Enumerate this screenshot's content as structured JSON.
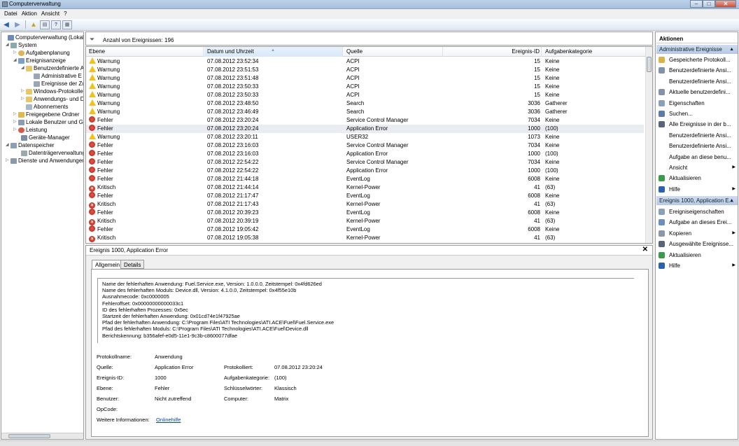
{
  "window": {
    "title": "Computerverwaltung",
    "min": "–",
    "max": "□",
    "close": "✕"
  },
  "menu": [
    "Datei",
    "Aktion",
    "Ansicht",
    "?"
  ],
  "tree": [
    {
      "label": "Computerverwaltung (Lokal)",
      "icon": "computer-icon"
    },
    {
      "label": "System",
      "icon": "system-icon"
    },
    {
      "label": "Aufgabenplanung",
      "icon": "clock-icon"
    },
    {
      "label": "Ereignisanzeige",
      "icon": "event-viewer-icon"
    },
    {
      "label": "Benutzerdefinierte A",
      "icon": "folder-icon"
    },
    {
      "label": "Administrative E",
      "icon": "filter-icon"
    },
    {
      "label": "Ereignisse der Zu",
      "icon": "filter-icon"
    },
    {
      "label": "Windows-Protokolle",
      "icon": "folder-icon"
    },
    {
      "label": "Anwendungs- und D",
      "icon": "folder-icon"
    },
    {
      "label": "Abonnements",
      "icon": "subscription-icon"
    },
    {
      "label": "Freigegebene Ordner",
      "icon": "shared-folder-icon"
    },
    {
      "label": "Lokale Benutzer und Gr",
      "icon": "users-icon"
    },
    {
      "label": "Leistung",
      "icon": "performance-icon"
    },
    {
      "label": "Geräte-Manager",
      "icon": "device-manager-icon"
    },
    {
      "label": "Datenspeicher",
      "icon": "storage-icon"
    },
    {
      "label": "Datenträgerverwaltung",
      "icon": "disk-icon"
    },
    {
      "label": "Dienste und Anwendungen",
      "icon": "services-icon"
    }
  ],
  "events": {
    "count_label": "Anzahl von Ereignissen: 196",
    "columns": [
      "Ebene",
      "Datum und Uhrzeit",
      "Quelle",
      "Ereignis-ID",
      "Aufgabenkategorie"
    ],
    "rows": [
      {
        "level": "Warnung",
        "type": "warn",
        "date": "07.08.2012 23:52:34",
        "source": "ACPI",
        "id": "15",
        "cat": "Keine"
      },
      {
        "level": "Warnung",
        "type": "warn",
        "date": "07.08.2012 23:51:53",
        "source": "ACPI",
        "id": "15",
        "cat": "Keine"
      },
      {
        "level": "Warnung",
        "type": "warn",
        "date": "07.08.2012 23:51:48",
        "source": "ACPI",
        "id": "15",
        "cat": "Keine"
      },
      {
        "level": "Warnung",
        "type": "warn",
        "date": "07.08.2012 23:50:33",
        "source": "ACPI",
        "id": "15",
        "cat": "Keine"
      },
      {
        "level": "Warnung",
        "type": "warn",
        "date": "07.08.2012 23:50:33",
        "source": "ACPI",
        "id": "15",
        "cat": "Keine"
      },
      {
        "level": "Warnung",
        "type": "warn",
        "date": "07.08.2012 23:48:50",
        "source": "Search",
        "id": "3036",
        "cat": "Gatherer"
      },
      {
        "level": "Warnung",
        "type": "warn",
        "date": "07.08.2012 23:46:49",
        "source": "Search",
        "id": "3036",
        "cat": "Gatherer"
      },
      {
        "level": "Fehler",
        "type": "err",
        "date": "07.08.2012 23:20:24",
        "source": "Service Control Manager",
        "id": "7034",
        "cat": "Keine"
      },
      {
        "level": "Fehler",
        "type": "err",
        "date": "07.08.2012 23:20:24",
        "source": "Application Error",
        "id": "1000",
        "cat": "(100)",
        "selected": true
      },
      {
        "level": "Warnung",
        "type": "warn",
        "date": "07.08.2012 23:20:11",
        "source": "USER32",
        "id": "1073",
        "cat": "Keine"
      },
      {
        "level": "Fehler",
        "type": "err",
        "date": "07.08.2012 23:16:03",
        "source": "Service Control Manager",
        "id": "7034",
        "cat": "Keine"
      },
      {
        "level": "Fehler",
        "type": "err",
        "date": "07.08.2012 23:16:03",
        "source": "Application Error",
        "id": "1000",
        "cat": "(100)"
      },
      {
        "level": "Fehler",
        "type": "err",
        "date": "07.08.2012 22:54:22",
        "source": "Service Control Manager",
        "id": "7034",
        "cat": "Keine"
      },
      {
        "level": "Fehler",
        "type": "err",
        "date": "07.08.2012 22:54:22",
        "source": "Application Error",
        "id": "1000",
        "cat": "(100)"
      },
      {
        "level": "Fehler",
        "type": "err",
        "date": "07.08.2012 21:44:18",
        "source": "EventLog",
        "id": "6008",
        "cat": "Keine"
      },
      {
        "level": "Kritisch",
        "type": "crit",
        "date": "07.08.2012 21:44:14",
        "source": "Kernel-Power",
        "id": "41",
        "cat": "(63)"
      },
      {
        "level": "Fehler",
        "type": "err",
        "date": "07.08.2012 21:17:47",
        "source": "EventLog",
        "id": "6008",
        "cat": "Keine"
      },
      {
        "level": "Kritisch",
        "type": "crit",
        "date": "07.08.2012 21:17:43",
        "source": "Kernel-Power",
        "id": "41",
        "cat": "(63)"
      },
      {
        "level": "Fehler",
        "type": "err",
        "date": "07.08.2012 20:39:23",
        "source": "EventLog",
        "id": "6008",
        "cat": "Keine"
      },
      {
        "level": "Kritisch",
        "type": "crit",
        "date": "07.08.2012 20:39:19",
        "source": "Kernel-Power",
        "id": "41",
        "cat": "(63)"
      },
      {
        "level": "Fehler",
        "type": "err",
        "date": "07.08.2012 19:05:42",
        "source": "EventLog",
        "id": "6008",
        "cat": "Keine"
      },
      {
        "level": "Kritisch",
        "type": "crit",
        "date": "07.08.2012 19:05:38",
        "source": "Kernel-Power",
        "id": "41",
        "cat": "(63)"
      }
    ]
  },
  "detail": {
    "title": "Ereignis 1000, Application Error",
    "close": "✕",
    "tabs": [
      "Allgemein",
      "Details"
    ],
    "description": [
      "Name der fehlerhaften Anwendung: Fuel.Service.exe, Version: 1.0.0.0, Zeitstempel: 0x4fd626ed",
      "Name des fehlerhaften Moduls: Device.dll, Version: 4.1.0.0, Zeitstempel: 0x4f55e10b",
      "Ausnahmecode: 0xc0000005",
      "Fehleroffset: 0x00000000000033c1",
      "ID des fehlerhaften Prozesses: 0x5ec",
      "Startzeit der fehlerhaften Anwendung: 0x01cd74e1f47925ae",
      "Pfad der fehlerhaften Anwendung: C:\\Program Files\\ATI Technologies\\ATI.ACE\\Fuel\\Fuel.Service.exe",
      "Pfad des fehlerhaften Moduls: C:\\Program Files\\ATI Technologies\\ATI.ACE\\Fuel\\Device.dll",
      "Berichtskennung: b356afef-e0d5-11e1-9c3b-c8600077dfae"
    ],
    "fields": {
      "protokollname_label": "Protokollname:",
      "protokollname": "Anwendung",
      "quelle_label": "Quelle:",
      "quelle": "Application Error",
      "protokolliert_label": "Protokolliert:",
      "protokolliert": "07.08.2012 23:20:24",
      "ereignisid_label": "Ereignis-ID:",
      "ereignisid": "1000",
      "aufgabenkat_label": "Aufgabenkategorie:",
      "aufgabenkat": "(100)",
      "ebene_label": "Ebene:",
      "ebene": "Fehler",
      "schluessel_label": "Schlüsselwörter:",
      "schluessel": "Klassisch",
      "benutzer_label": "Benutzer:",
      "benutzer": "Nicht zutreffend",
      "computer_label": "Computer:",
      "computer": "Matrix",
      "opcode_label": "OpCode:",
      "weitere_label": "Weitere Informationen:",
      "weitere_link": "Onlinehilfe"
    }
  },
  "actions": {
    "header": "Aktionen",
    "group1": "Administrative Ereignisse",
    "group1_items": [
      {
        "label": "Gespeicherte Protokoll...",
        "icon": "open-log-icon"
      },
      {
        "label": "Benutzerdefinierte Ansi...",
        "icon": "filter-icon"
      },
      {
        "label": "Benutzerdefinierte Ansi...",
        "icon": "none"
      },
      {
        "label": "Aktuelle benutzerdefini...",
        "icon": "filter-icon"
      },
      {
        "label": "Eigenschaften",
        "icon": "properties-icon"
      },
      {
        "label": "Suchen...",
        "icon": "search-icon"
      },
      {
        "label": "Alle Ereignisse in der b...",
        "icon": "save-icon"
      },
      {
        "label": "Benutzerdefinierte Ansi...",
        "icon": "none"
      },
      {
        "label": "Benutzerdefinierte Ansi...",
        "icon": "none"
      },
      {
        "label": "Aufgabe an diese benu...",
        "icon": "none"
      },
      {
        "label": "Ansicht",
        "icon": "none",
        "submenu": true
      },
      {
        "label": "Aktualisieren",
        "icon": "refresh-icon"
      },
      {
        "label": "Hilfe",
        "icon": "help-icon",
        "submenu": true
      }
    ],
    "group2": "Ereignis 1000, Application E...",
    "group2_items": [
      {
        "label": "Ereigniseigenschaften",
        "icon": "properties-icon"
      },
      {
        "label": "Aufgabe an dieses Erei...",
        "icon": "task-icon"
      },
      {
        "label": "Kopieren",
        "icon": "copy-icon",
        "submenu": true
      },
      {
        "label": "Ausgewählte Ereignisse...",
        "icon": "save-icon"
      },
      {
        "label": "Aktualisieren",
        "icon": "refresh-icon"
      },
      {
        "label": "Hilfe",
        "icon": "help-icon",
        "submenu": true
      }
    ]
  }
}
